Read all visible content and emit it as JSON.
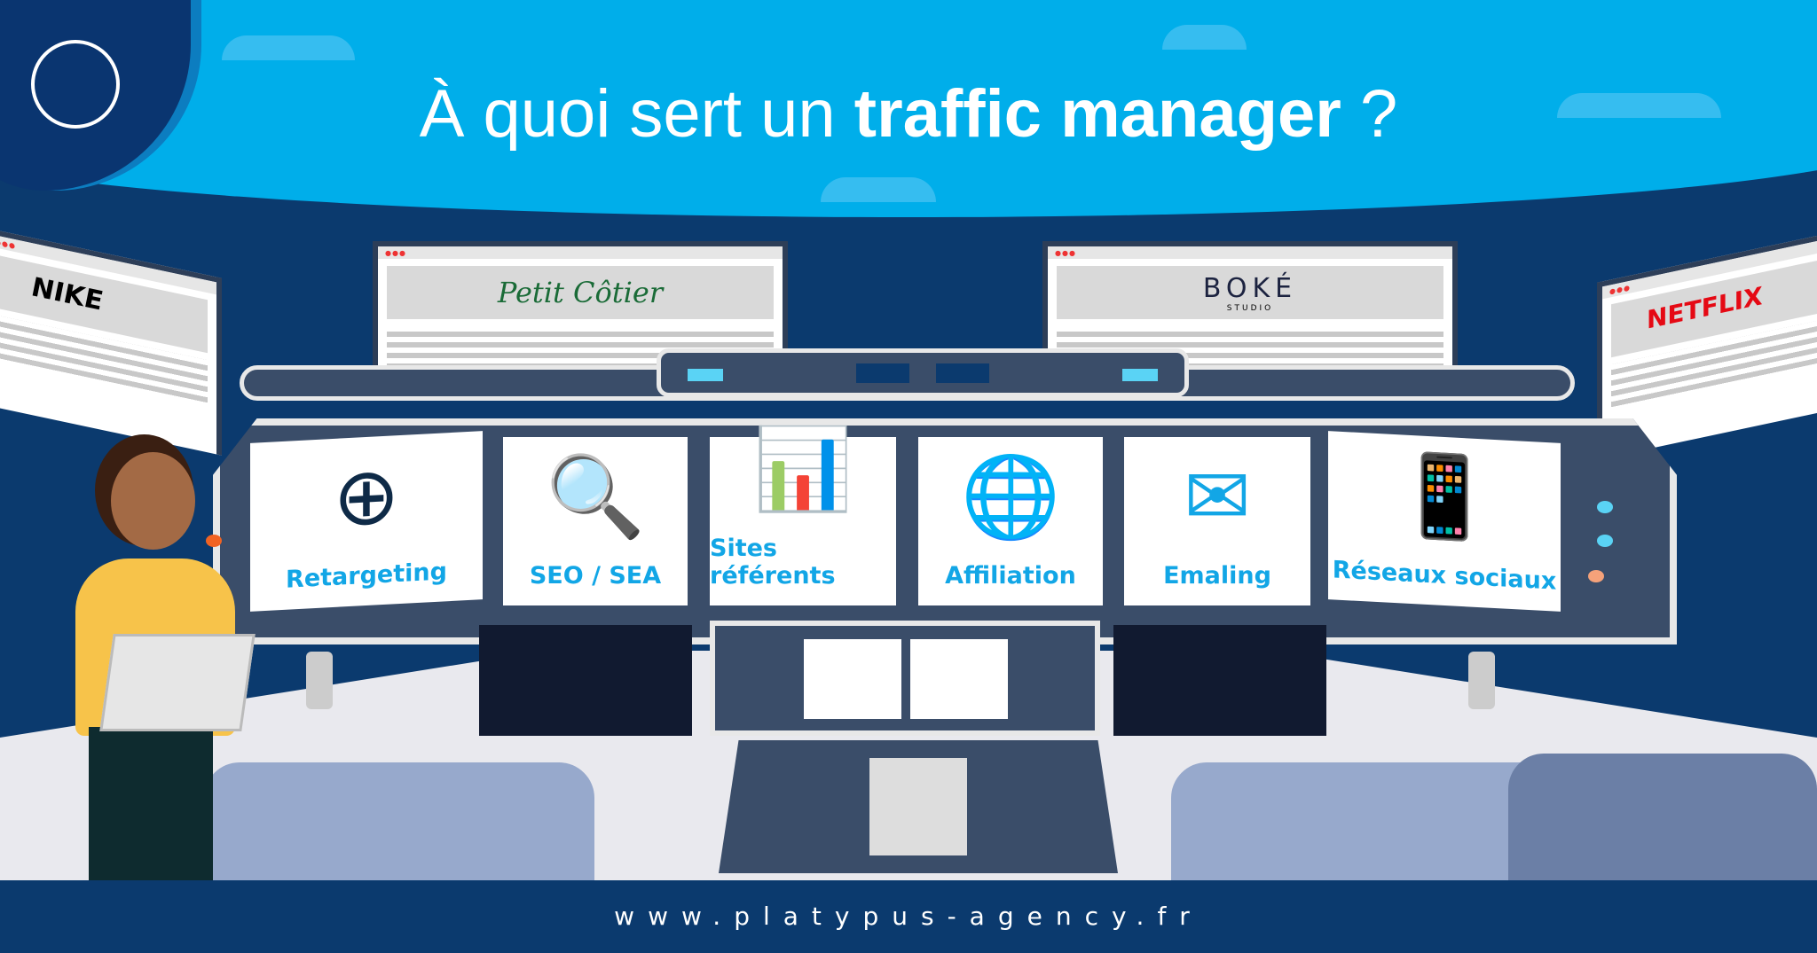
{
  "header": {
    "title_regular": "À quoi sert un ",
    "title_bold": "traffic manager",
    "title_end": " ?"
  },
  "brands": {
    "nike": "NIKE",
    "petit_cotier": "Petit Côtier",
    "boke": "BOKÉ",
    "boke_sub": "STUDIO",
    "netflix": "NETFLIX"
  },
  "cards": [
    {
      "label": "Retargeting",
      "icon": "target-user-icon"
    },
    {
      "label": "SEO / SEA",
      "icon": "browser-search-icon"
    },
    {
      "label": "Sites référents",
      "icon": "chart-icon"
    },
    {
      "label": "Affiliation",
      "icon": "globe-network-icon"
    },
    {
      "label": "Emaling",
      "icon": "email-icon"
    },
    {
      "label": "Réseaux sociaux",
      "icon": "social-media-icon"
    }
  ],
  "footer": {
    "url": "www.platypus-agency.fr"
  },
  "colors": {
    "sky": "#00aeea",
    "navy": "#0b3a6e",
    "panel": "#3a4d69",
    "accent_text": "#12a6e6",
    "orange": "#f26322"
  }
}
